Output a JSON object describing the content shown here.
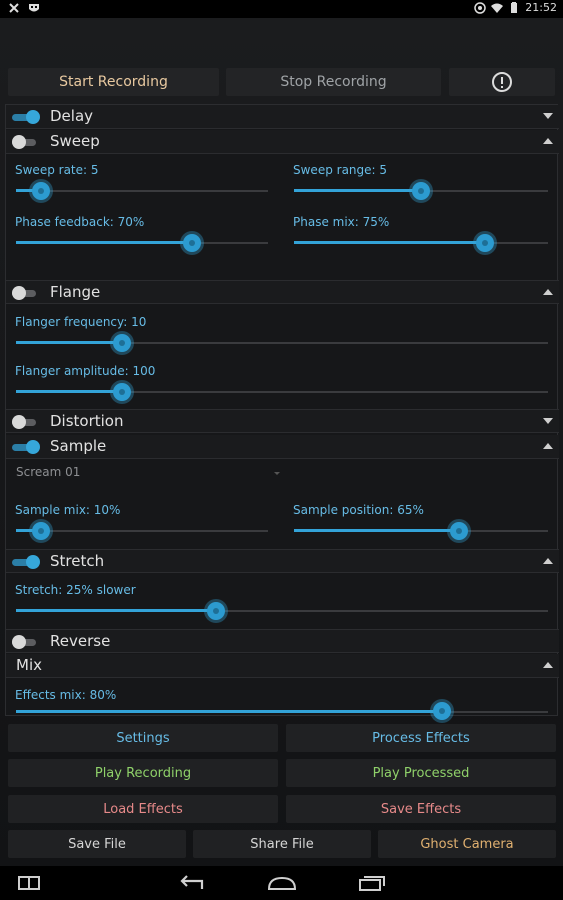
{
  "status": {
    "time": "21:52"
  },
  "top": {
    "start": "Start Recording",
    "stop": "Stop Recording"
  },
  "sections": {
    "delay": {
      "title": "Delay",
      "on": true
    },
    "sweep": {
      "title": "Sweep",
      "on": false,
      "rate_label": "Sweep rate: 5",
      "range_label": "Sweep range: 5",
      "feedback_label": "Phase feedback: 70%",
      "mix_label": "Phase mix: 75%"
    },
    "flange": {
      "title": "Flange",
      "on": false,
      "freq_label": "Flanger frequency: 10",
      "amp_label": "Flanger amplitude: 100"
    },
    "distortion": {
      "title": "Distortion",
      "on": false
    },
    "sample": {
      "title": "Sample",
      "on": true,
      "selected": "Scream 01",
      "mix_label": "Sample mix: 10%",
      "pos_label": "Sample position: 65%"
    },
    "stretch": {
      "title": "Stretch",
      "on": true,
      "label": "Stretch: 25% slower"
    },
    "reverse": {
      "title": "Reverse",
      "on": false
    },
    "mix": {
      "title": "Mix",
      "label": "Effects mix: 80%"
    }
  },
  "sliders": {
    "sweep_rate": 0.1,
    "sweep_range": 0.5,
    "phase_feedback": 0.7,
    "phase_mix": 0.75,
    "flanger_freq": 0.2,
    "flanger_amp": 0.2,
    "sample_mix": 0.1,
    "sample_pos": 0.65,
    "stretch": 0.375,
    "effects_mix": 0.8
  },
  "bottom": {
    "settings": "Settings",
    "process": "Process Effects",
    "play_rec": "Play Recording",
    "play_proc": "Play Processed",
    "load": "Load Effects",
    "save_fx": "Save Effects",
    "save_file": "Save File",
    "share": "Share File",
    "ghost": "Ghost Camera"
  },
  "colors": {
    "accent": "#33a3d8",
    "blue_text": "#67bce6",
    "green_text": "#8fd16a",
    "red_text": "#e78a8a",
    "orange_text": "#e0b070"
  }
}
